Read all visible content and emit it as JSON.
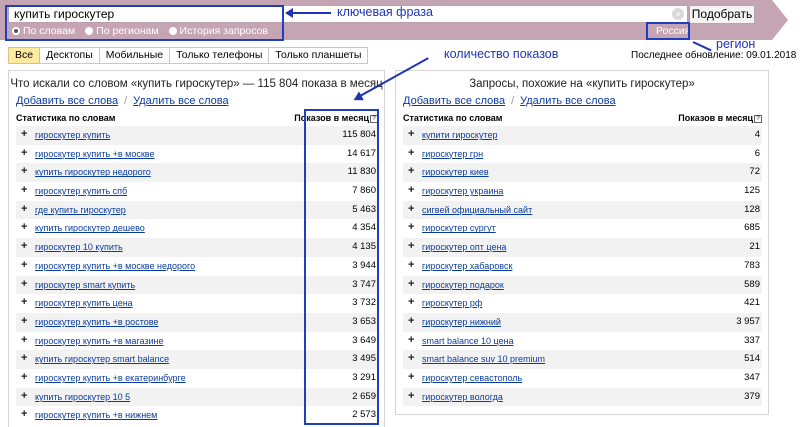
{
  "search": {
    "value": "купить гироскутер",
    "clear_icon": "close-circle-icon",
    "button_label": "Подобрать"
  },
  "radios": [
    {
      "label": "По словам",
      "selected": true
    },
    {
      "label": "По регионам",
      "selected": false
    },
    {
      "label": "История запросов",
      "selected": false
    }
  ],
  "region": {
    "label": "Россия"
  },
  "annotations": {
    "key_phrase": "ключевая фраза",
    "show_count": "количество показов",
    "region": "регион"
  },
  "tabs": [
    "Все",
    "Десктопы",
    "Мобильные",
    "Только телефоны",
    "Только планшеты"
  ],
  "last_update": "Последнее обновление: 09.01.2018",
  "left_panel": {
    "title": "Что искали со словом «купить гироскутер» — 115 804 показа в месяц",
    "add_all": "Добавить все слова",
    "separator": "/",
    "remove_all": "Удалить все слова",
    "col_words": "Статистика по словам",
    "col_shows": "Показов в месяц",
    "rows": [
      {
        "phrase": "гироскутер купить",
        "count": "115 804"
      },
      {
        "phrase": "гироскутер купить +в москве",
        "count": "14 617"
      },
      {
        "phrase": "купить гироскутер недорого",
        "count": "11 830"
      },
      {
        "phrase": "гироскутер купить спб",
        "count": "7 860"
      },
      {
        "phrase": "где купить гироскутер",
        "count": "5 463"
      },
      {
        "phrase": "купить гироскутер дешево",
        "count": "4 354"
      },
      {
        "phrase": "гироскутер 10 купить",
        "count": "4 135"
      },
      {
        "phrase": "гироскутер купить +в москве недорого",
        "count": "3 944"
      },
      {
        "phrase": "гироскутер smart купить",
        "count": "3 747"
      },
      {
        "phrase": "гироскутер купить цена",
        "count": "3 732"
      },
      {
        "phrase": "гироскутер купить +в ростове",
        "count": "3 653"
      },
      {
        "phrase": "гироскутер купить +в магазине",
        "count": "3 649"
      },
      {
        "phrase": "купить гироскутер smart balance",
        "count": "3 495"
      },
      {
        "phrase": "гироскутер купить +в екатеринбурге",
        "count": "3 291"
      },
      {
        "phrase": "купить гироскутер 10 5",
        "count": "2 659"
      },
      {
        "phrase": "гироскутер купить +в нижнем",
        "count": "2 573"
      }
    ]
  },
  "right_panel": {
    "title": "Запросы, похожие на «купить гироскутер»",
    "add_all": "Добавить все слова",
    "separator": "/",
    "remove_all": "Удалить все слова",
    "col_words": "Статистика по словам",
    "col_shows": "Показов в месяц",
    "rows": [
      {
        "phrase": "купити гироскутер",
        "count": "4"
      },
      {
        "phrase": "гироскутер грн",
        "count": "6"
      },
      {
        "phrase": "гироскутер киев",
        "count": "72"
      },
      {
        "phrase": "гироскутер украина",
        "count": "125"
      },
      {
        "phrase": "сигвей официальный сайт",
        "count": "128"
      },
      {
        "phrase": "гироскутер сургут",
        "count": "685"
      },
      {
        "phrase": "гироскутер опт цена",
        "count": "21"
      },
      {
        "phrase": "гироскутер хабаровск",
        "count": "783"
      },
      {
        "phrase": "гироскутер подарок",
        "count": "589"
      },
      {
        "phrase": "гироскутер рф",
        "count": "421"
      },
      {
        "phrase": "гироскутер нижний",
        "count": "3 957"
      },
      {
        "phrase": "smart balance 10 цена",
        "count": "337"
      },
      {
        "phrase": "smart balance suv 10 premium",
        "count": "514"
      },
      {
        "phrase": "гироскутер севастополь",
        "count": "347"
      },
      {
        "phrase": "гироскутер вологда",
        "count": "379"
      }
    ]
  },
  "colors": {
    "topbar": "#c5a5b4",
    "link": "#0a3c9e",
    "annotation": "#2133b3",
    "active_tab": "#ffeba0"
  }
}
